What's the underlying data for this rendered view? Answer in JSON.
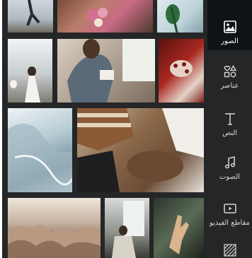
{
  "sidebar": {
    "items": [
      {
        "label": "الصور",
        "icon": "image-icon",
        "active": true
      },
      {
        "label": "عناصر",
        "icon": "elements-icon",
        "active": false
      },
      {
        "label": "النص",
        "icon": "text-icon",
        "active": false
      },
      {
        "label": "الصوت",
        "icon": "music-note-icon",
        "active": false
      },
      {
        "label": "مقاطع الفيديو",
        "icon": "video-icon",
        "active": false
      },
      {
        "label": "",
        "icon": "pattern-icon",
        "active": false
      }
    ]
  },
  "photos": [
    {
      "name": "photo-person-sky"
    },
    {
      "name": "photo-flowers-dark"
    },
    {
      "name": "photo-woman-plant"
    },
    {
      "name": "photo-people-sunlight"
    },
    {
      "name": "photo-person-window-reading"
    },
    {
      "name": "photo-woman-beach"
    },
    {
      "name": "photo-hands-red-sweater"
    },
    {
      "name": "photo-aerial-water"
    },
    {
      "name": "photo-friends-puppy"
    },
    {
      "name": "photo-rock-formations"
    },
    {
      "name": "photo-woman-window"
    },
    {
      "name": "photo-hand-dark"
    }
  ],
  "colors": {
    "panel": "#252627",
    "active_tab": "#0e1318",
    "text": "#d6d6d6"
  }
}
